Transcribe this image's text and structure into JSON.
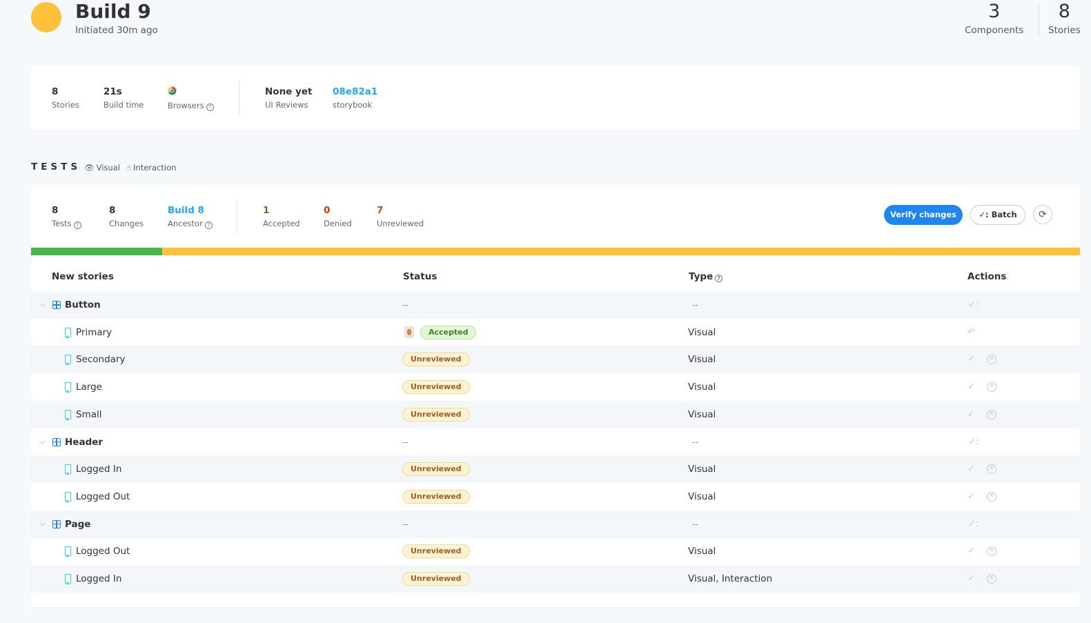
{
  "header": {
    "title": "Build 9",
    "subtitle": "Initiated 30m ago",
    "stats": [
      {
        "value": "3",
        "label": "Components"
      },
      {
        "value": "8",
        "label": "Stories"
      }
    ]
  },
  "summary": {
    "stories": {
      "value": "8",
      "label": "Stories"
    },
    "build_time": {
      "value": "21s",
      "label": "Build time"
    },
    "browsers": {
      "label": "Browsers"
    },
    "ui_reviews": {
      "value": "None yet",
      "label": "UI Reviews"
    },
    "storybook": {
      "value": "08e82a1",
      "label": "storybook"
    }
  },
  "tests": {
    "heading": "TESTS",
    "tags": [
      "Visual",
      "Interaction"
    ],
    "stats": {
      "tests": {
        "value": "8",
        "label": "Tests"
      },
      "changes": {
        "value": "8",
        "label": "Changes"
      },
      "ancestor": {
        "value": "Build 8",
        "label": "Ancestor"
      },
      "accepted": {
        "value": "1",
        "label": "Accepted"
      },
      "denied": {
        "value": "0",
        "label": "Denied"
      },
      "unreviewed": {
        "value": "7",
        "label": "Unreviewed"
      }
    },
    "buttons": {
      "verify": "Verify changes",
      "batch": "✓: Batch"
    },
    "progress_accepted_fraction": 0.125,
    "colors": {
      "accepted": "#48b44a",
      "pending": "#fec23a",
      "primary": "#1e86f0"
    }
  },
  "table": {
    "columns": [
      "New stories",
      "Status",
      "Type",
      "Actions"
    ],
    "rows": [
      {
        "kind": "group",
        "name": "Button",
        "status": "--",
        "type": "--"
      },
      {
        "kind": "story",
        "name": "Primary",
        "status": "Accepted",
        "type": "Visual"
      },
      {
        "kind": "story",
        "name": "Secondary",
        "status": "Unreviewed",
        "type": "Visual"
      },
      {
        "kind": "story",
        "name": "Large",
        "status": "Unreviewed",
        "type": "Visual"
      },
      {
        "kind": "story",
        "name": "Small",
        "status": "Unreviewed",
        "type": "Visual"
      },
      {
        "kind": "group",
        "name": "Header",
        "status": "--",
        "type": "--"
      },
      {
        "kind": "story",
        "name": "Logged In",
        "status": "Unreviewed",
        "type": "Visual"
      },
      {
        "kind": "story",
        "name": "Logged Out",
        "status": "Unreviewed",
        "type": "Visual"
      },
      {
        "kind": "group",
        "name": "Page",
        "status": "--",
        "type": "--"
      },
      {
        "kind": "story",
        "name": "Logged Out",
        "status": "Unreviewed",
        "type": "Visual"
      },
      {
        "kind": "story",
        "name": "Logged In",
        "status": "Unreviewed",
        "type": "Visual, Interaction"
      }
    ]
  }
}
